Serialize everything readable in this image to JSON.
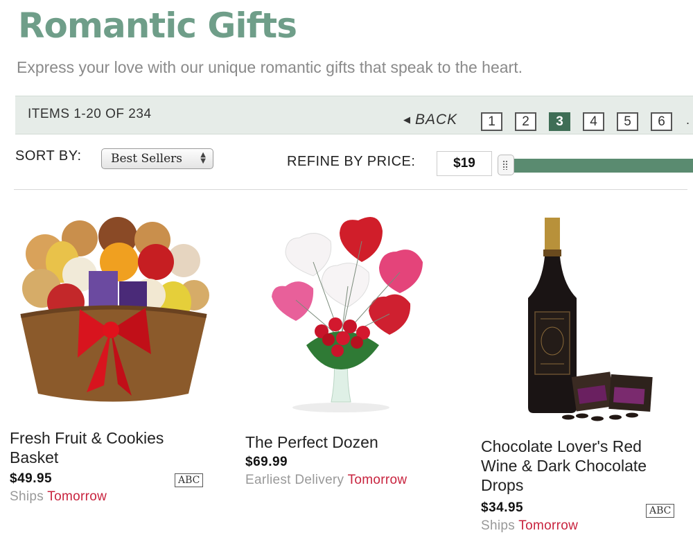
{
  "page": {
    "title": "Romantic Gifts",
    "subtitle": "Express your love with our unique romantic gifts that speak to the heart."
  },
  "pager": {
    "items_text": "ITEMS 1-20 OF 234",
    "back_label": "BACK",
    "pages": [
      "1",
      "2",
      "3",
      "4",
      "5",
      "6"
    ],
    "current_page": "3",
    "more": "."
  },
  "sort": {
    "label": "SORT BY:",
    "selected": "Best Sellers"
  },
  "refine": {
    "label": "REFINE BY PRICE:",
    "min_price": "$19"
  },
  "colors": {
    "brand_green": "#6f9e89",
    "dark_green": "#3f6e56",
    "accent_red": "#c8233e"
  },
  "products": [
    {
      "name": "Fresh Fruit & Cookies Basket",
      "price": "$49.95",
      "delivery_prefix": "Ships",
      "delivery_when": "Tomorrow",
      "badge": "ABC",
      "image_icon": "fruit-cookie-basket"
    },
    {
      "name": "The Perfect Dozen",
      "price": "$69.99",
      "delivery_prefix": "Earliest Delivery",
      "delivery_when": "Tomorrow",
      "image_icon": "roses-balloons-bouquet"
    },
    {
      "name": "Chocolate Lover's Red Wine & Dark Chocolate Drops",
      "price": "$34.95",
      "delivery_prefix": "Ships",
      "delivery_when": "Tomorrow",
      "badge": "ABC",
      "image_icon": "wine-bottle-chocolates"
    }
  ]
}
